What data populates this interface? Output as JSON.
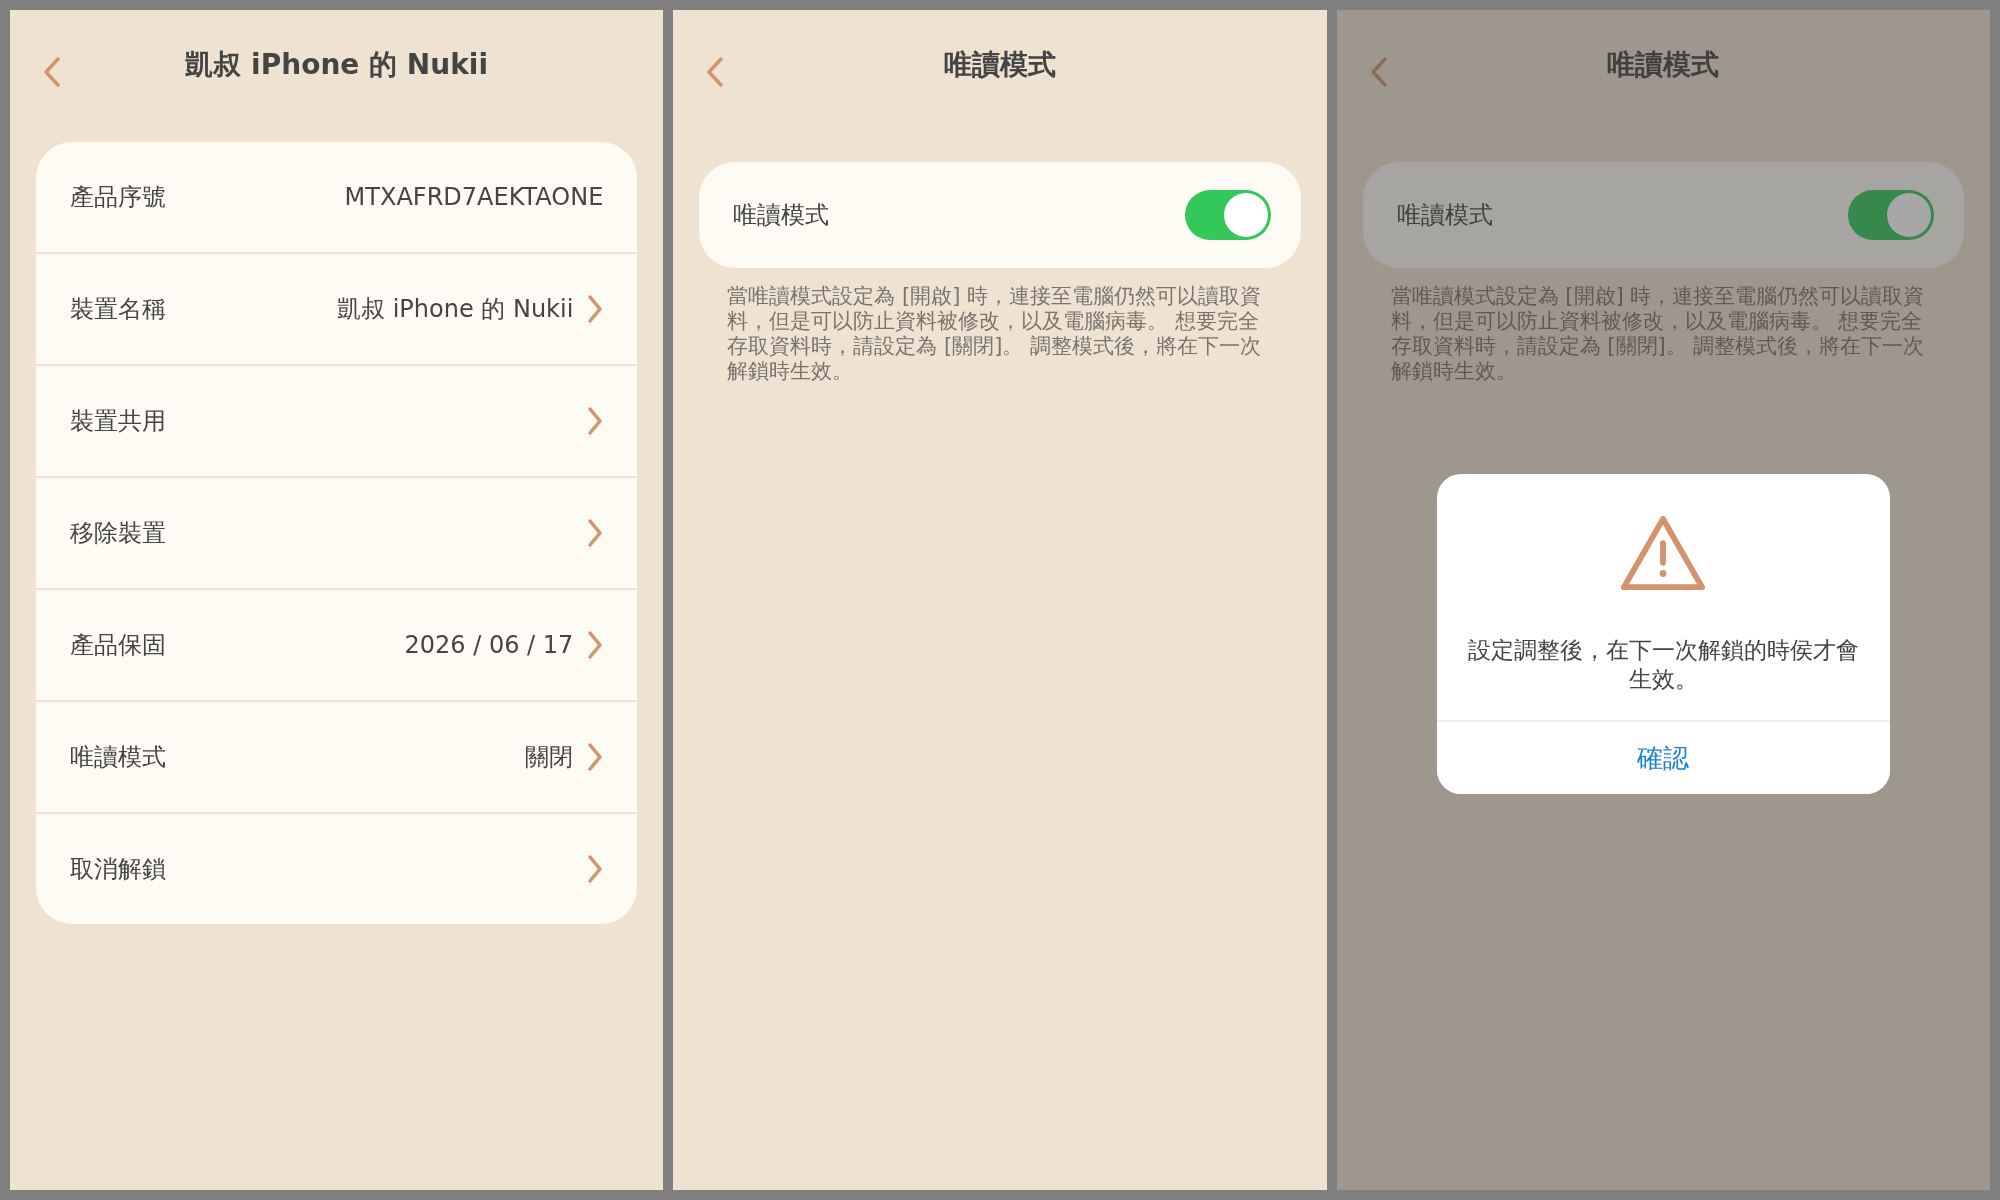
{
  "device_panel": {
    "title": "凱叔 iPhone 的 Nukii",
    "rows": [
      {
        "label": "產品序號",
        "value": "MTXAFRD7AEKTAONE",
        "chevron": false
      },
      {
        "label": "裝置名稱",
        "value": "凱叔 iPhone 的 Nukii",
        "chevron": true
      },
      {
        "label": "裝置共用",
        "chevron": true
      },
      {
        "label": "移除裝置",
        "chevron": true
      },
      {
        "label": "產品保固",
        "value": "2026 / 06 / 17",
        "chevron": true
      },
      {
        "label": "唯讀模式",
        "value": "關閉",
        "chevron": true
      },
      {
        "label": "取消解鎖",
        "chevron": true
      }
    ]
  },
  "readonly_panel": {
    "title": "唯讀模式",
    "setting": {
      "label": "唯讀模式",
      "on": true
    },
    "description": "當唯讀模式設定為 [開啟] 時，連接至電腦仍然可以讀取資料，但是可以防止資料被修改，以及電腦病毒。 想要完全存取資料時，請設定為 [關閉]。 調整模式後，將在下一次解鎖時生效。"
  },
  "confirm_panel": {
    "title": "唯讀模式",
    "setting": {
      "label": "唯讀模式",
      "on": true
    },
    "description": "當唯讀模式設定為 [開啟] 時，連接至電腦仍然可以讀取資料，但是可以防止資料被修改，以及電腦病毒。 想要完全存取資料時，請設定為 [關閉]。 調整模式後，將在下一次解鎖時生效。",
    "dialog": {
      "message": "設定調整後，在下一次解鎖的時侯才會生效。",
      "button": "確認"
    }
  }
}
